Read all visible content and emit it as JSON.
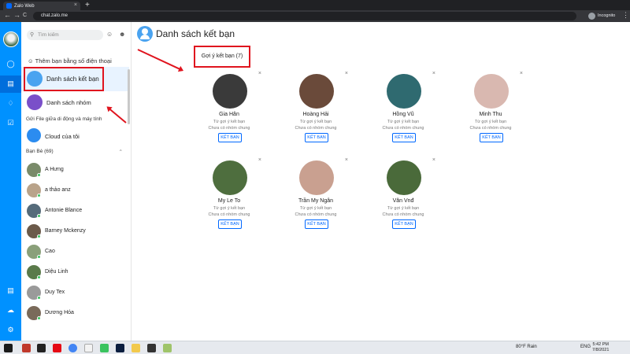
{
  "browser": {
    "tab_title": "Zalo Web",
    "tab_close": "×",
    "new_tab": "+",
    "url": "chat.zalo.me",
    "incognito": "Incognito",
    "menu": "⋮",
    "back": "←",
    "forward": "→",
    "reload": "C"
  },
  "sidebar": {
    "search_placeholder": "Tìm kiếm",
    "add_phone": "Thêm bạn bằng số điện thoại",
    "friend_list": "Danh sách kết bạn",
    "group_list": "Danh sách nhóm",
    "send_file": "Gửi File giữa di động và máy tính",
    "cloud": "Cloud của tôi",
    "friends_header": "Bạn Bè (69)",
    "friends": [
      {
        "name": "A Hưng",
        "color": "#7a8b6a"
      },
      {
        "name": "a thảo anz",
        "color": "#b9a38a"
      },
      {
        "name": "Antonie Blance",
        "color": "#556b7a"
      },
      {
        "name": "Barney Mckenzy",
        "color": "#6b5a4a"
      },
      {
        "name": "Cao",
        "color": "#8aa07a"
      },
      {
        "name": "Diệu Linh",
        "color": "#5a7a4a"
      },
      {
        "name": "Duy Tex",
        "color": "#9a9a9a"
      },
      {
        "name": "Dương Hóa",
        "color": "#7a6a5a"
      }
    ]
  },
  "main": {
    "title": "Danh sách kết bạn",
    "suggest_label": "Gợi ý kết bạn (7)",
    "close": "×",
    "line1": "Từ gợi ý kết bạn",
    "line2": "Chưa có nhóm chung",
    "button": "KẾT BẠN",
    "cards": [
      {
        "name": "Gia Hân",
        "color": "#3a3a3a"
      },
      {
        "name": "Hoàng Hải",
        "color": "#6a4a3a"
      },
      {
        "name": "Hồng Vũ",
        "color": "#2f6a70"
      },
      {
        "name": "Minh Thu",
        "color": "#d9b8b0"
      },
      {
        "name": "My Le To",
        "color": "#4e6e3e"
      },
      {
        "name": "Trần My Ngân",
        "color": "#c9a090"
      },
      {
        "name": "Văn Vnđ",
        "color": "#4a6a3a"
      }
    ]
  },
  "taskbar": {
    "weather": "80°F Rain",
    "lang": "ENG",
    "time": "5:42 PM",
    "date": "7/8/2021"
  },
  "colors": {
    "accent": "#0068ff",
    "rail": "#0091ff",
    "highlight": "#e0141e"
  }
}
